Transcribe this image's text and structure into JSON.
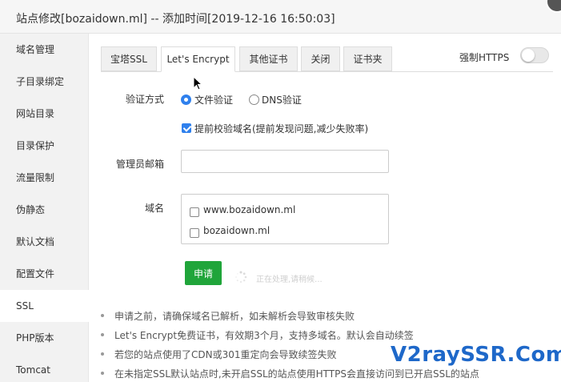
{
  "window": {
    "title": "站点修改[bozaidown.ml] -- 添加时间[2019-12-16 16:50:03]"
  },
  "sidebar": {
    "items": [
      {
        "label": "域名管理"
      },
      {
        "label": "子目录绑定"
      },
      {
        "label": "网站目录"
      },
      {
        "label": "目录保护"
      },
      {
        "label": "流量限制"
      },
      {
        "label": "伪静态"
      },
      {
        "label": "默认文档"
      },
      {
        "label": "配置文件"
      },
      {
        "label": "SSL",
        "active": true
      },
      {
        "label": "PHP版本"
      },
      {
        "label": "Tomcat"
      }
    ]
  },
  "tabs": [
    {
      "label": "宝塔SSL"
    },
    {
      "label": "Let's Encrypt",
      "active": true
    },
    {
      "label": "其他证书"
    },
    {
      "label": "关闭"
    },
    {
      "label": "证书夹"
    }
  ],
  "force_https": {
    "label": "强制HTTPS",
    "enabled": false
  },
  "form": {
    "verify_label": "验证方式",
    "verify_options": [
      {
        "label": "文件验证",
        "checked": true
      },
      {
        "label": "DNS验证",
        "checked": false
      }
    ],
    "precheck": {
      "label": "提前校验域名(提前发现问题,减少失败率)",
      "checked": true
    },
    "email_label": "管理员邮箱",
    "email_value": "",
    "domain_label": "域名",
    "domains": [
      {
        "label": "www.bozaidown.ml",
        "checked": false
      },
      {
        "label": "bozaidown.ml",
        "checked": false
      }
    ],
    "apply_label": "申请",
    "loading_text": "正在处理,请稍候..."
  },
  "notes": [
    "申请之前，请确保域名已解析，如未解析会导致审核失败",
    "Let's Encrypt免费证书，有效期3个月，支持多域名。默认会自动续签",
    "若您的站点使用了CDN或301重定向会导致续签失败",
    "在未指定SSL默认站点时,未开启SSL的站点使用HTTPS会直接访问到已开启SSL的站点"
  ],
  "watermark": "V2raySSR.Com",
  "colors": {
    "accent": "#20a53a",
    "radio_checked": "#2f80ed",
    "watermark": "#1e68c9"
  }
}
